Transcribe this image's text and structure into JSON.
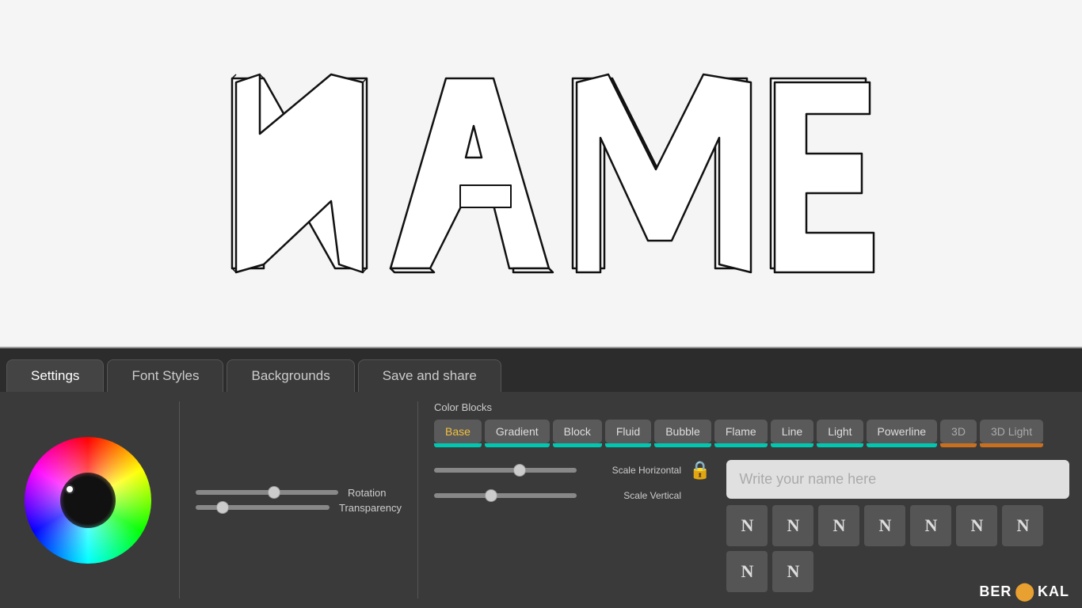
{
  "canvas": {
    "background": "#f5f5f5",
    "display_text": "NAME"
  },
  "tabs": [
    {
      "id": "settings",
      "label": "Settings",
      "active": true
    },
    {
      "id": "font-styles",
      "label": "Font Styles",
      "active": false
    },
    {
      "id": "backgrounds",
      "label": "Backgrounds",
      "active": false
    },
    {
      "id": "save-share",
      "label": "Save and share",
      "active": false
    }
  ],
  "settings": {
    "color_blocks_label": "Color Blocks",
    "rotation_label": "Rotation",
    "transparency_label": "Transparency",
    "scale_horizontal_label": "Scale Horizontal",
    "scale_vertical_label": "Scale Vertical",
    "rotation_value": 55,
    "transparency_value": 20,
    "scale_h_value": 60,
    "scale_v_value": 40
  },
  "style_buttons": [
    {
      "id": "base",
      "label": "Base",
      "active": true,
      "indicator": "teal"
    },
    {
      "id": "gradient",
      "label": "Gradient",
      "active": false,
      "indicator": "teal"
    },
    {
      "id": "block",
      "label": "Block",
      "active": false,
      "indicator": "teal"
    },
    {
      "id": "fluid",
      "label": "Fluid",
      "active": false,
      "indicator": "teal"
    },
    {
      "id": "bubble",
      "label": "Bubble",
      "active": false,
      "indicator": "teal"
    },
    {
      "id": "flame",
      "label": "Flame",
      "active": false,
      "indicator": "teal"
    },
    {
      "id": "line",
      "label": "Line",
      "active": false,
      "indicator": "teal"
    },
    {
      "id": "light",
      "label": "Light",
      "active": false,
      "indicator": "teal"
    },
    {
      "id": "powerline",
      "label": "Powerline",
      "active": false,
      "indicator": "teal"
    },
    {
      "id": "3d",
      "label": "3D",
      "active": false,
      "indicator": "orange"
    },
    {
      "id": "3d-light",
      "label": "3D Light",
      "active": false,
      "indicator": "orange"
    }
  ],
  "name_input": {
    "placeholder": "Write your name here",
    "value": ""
  },
  "char_buttons": [
    "N",
    "N",
    "N",
    "N",
    "N",
    "N",
    "N",
    "N",
    "N"
  ],
  "branding": {
    "text": "BEROKAL"
  }
}
